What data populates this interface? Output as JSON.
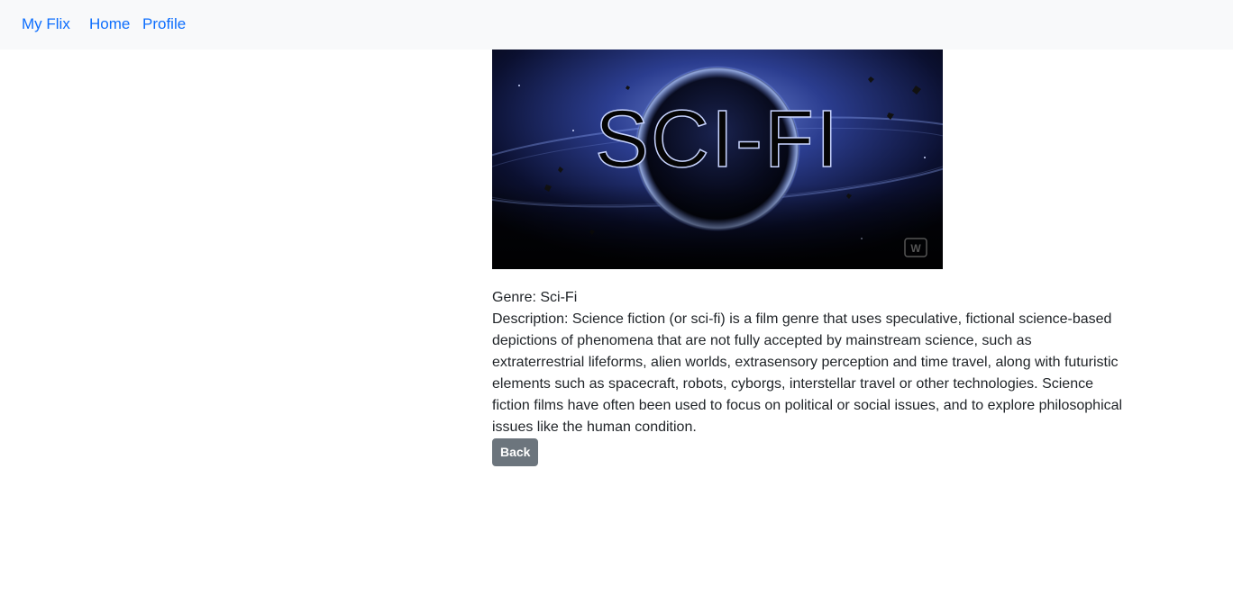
{
  "navbar": {
    "brand": "My Flix",
    "links": [
      {
        "label": "Home"
      },
      {
        "label": "Profile"
      }
    ],
    "link_color": "#0d6efd",
    "background": "#f8f9fa"
  },
  "genre": {
    "image_text": "SCI-FI",
    "image_watermark": "W",
    "name_label": "Genre: ",
    "name": "Sci-Fi",
    "description_label": "Description: ",
    "description": "Science fiction (or sci-fi) is a film genre that uses speculative, fictional science-based depictions of phenomena that are not fully accepted by mainstream science, such as extraterrestrial lifeforms, alien worlds, extrasensory perception and time travel, along with futuristic elements such as spacecraft, robots, cyborgs, interstellar travel or other technologies. Science fiction films have often been used to focus on political or social issues, and to explore philosophical issues like the human condition."
  },
  "actions": {
    "back_label": "Back",
    "back_color": "#6c757d"
  }
}
